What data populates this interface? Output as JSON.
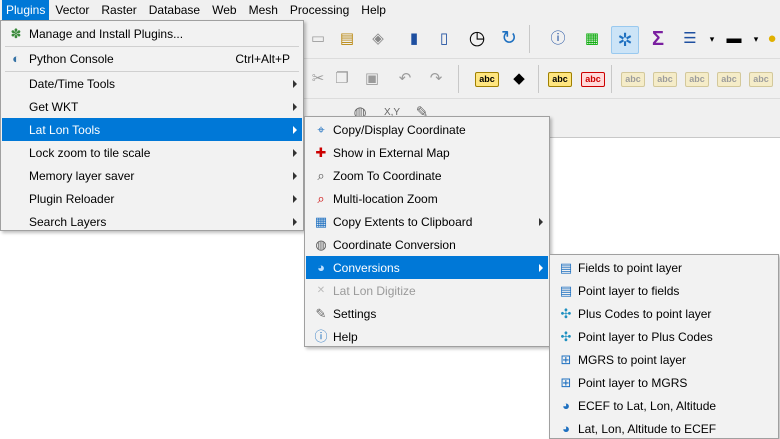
{
  "menubar": {
    "items": [
      "Plugins",
      "Vector",
      "Raster",
      "Database",
      "Web",
      "Mesh",
      "Processing",
      "Help"
    ],
    "active": "Plugins"
  },
  "plugins_menu": {
    "items": [
      {
        "label": "Manage and Install Plugins...",
        "icon": "puzzle-icon"
      },
      {
        "label": "Python Console",
        "shortcut": "Ctrl+Alt+P",
        "icon": "python-icon"
      },
      {
        "label": "Date/Time Tools",
        "submenu": true
      },
      {
        "label": "Get WKT",
        "submenu": true
      },
      {
        "label": "Lat Lon Tools",
        "submenu": true,
        "highlighted": true
      },
      {
        "label": "Lock zoom to tile scale",
        "submenu": true
      },
      {
        "label": "Memory layer saver",
        "submenu": true
      },
      {
        "label": "Plugin Reloader",
        "submenu": true
      },
      {
        "label": "Search Layers",
        "submenu": true
      }
    ]
  },
  "latlon_menu": {
    "items": [
      {
        "label": "Copy/Display Coordinate",
        "icon": "copy-coordinate-icon"
      },
      {
        "label": "Show in External Map",
        "icon": "external-map-icon"
      },
      {
        "label": "Zoom To Coordinate",
        "icon": "zoom-coordinate-icon"
      },
      {
        "label": "Multi-location Zoom",
        "icon": "multi-zoom-icon"
      },
      {
        "label": "Copy Extents to Clipboard",
        "icon": "copy-extents-icon",
        "submenu": true
      },
      {
        "label": "Coordinate Conversion",
        "icon": "globe-icon"
      },
      {
        "label": "Conversions",
        "icon": "conversions-icon",
        "submenu": true,
        "highlighted": true
      },
      {
        "label": "Lat Lon Digitize",
        "icon": "digitize-icon",
        "disabled": true
      },
      {
        "label": "Settings",
        "icon": "settings-icon"
      },
      {
        "label": "Help",
        "icon": "help-icon"
      }
    ]
  },
  "conversions_menu": {
    "items": [
      {
        "label": "Fields to point layer",
        "icon": "table-icon"
      },
      {
        "label": "Point layer to fields",
        "icon": "table-icon"
      },
      {
        "label": "Plus Codes to point layer",
        "icon": "plus-code-icon"
      },
      {
        "label": "Point layer to Plus Codes",
        "icon": "plus-code-icon"
      },
      {
        "label": "MGRS to point layer",
        "icon": "grid-icon"
      },
      {
        "label": "Point layer to MGRS",
        "icon": "grid-point-icon"
      },
      {
        "label": "ECEF to Lat, Lon, Altitude",
        "icon": "ecef-icon"
      },
      {
        "label": "Lat, Lon, Altitude to ECEF",
        "icon": "ecef-icon"
      }
    ]
  },
  "toolbar": {
    "label_abc": "abc",
    "coord_label": "X,Y",
    "sigma": "Σ"
  },
  "colors": {
    "highlight": "#0078d7",
    "menu_bg": "#f2f2f2"
  }
}
